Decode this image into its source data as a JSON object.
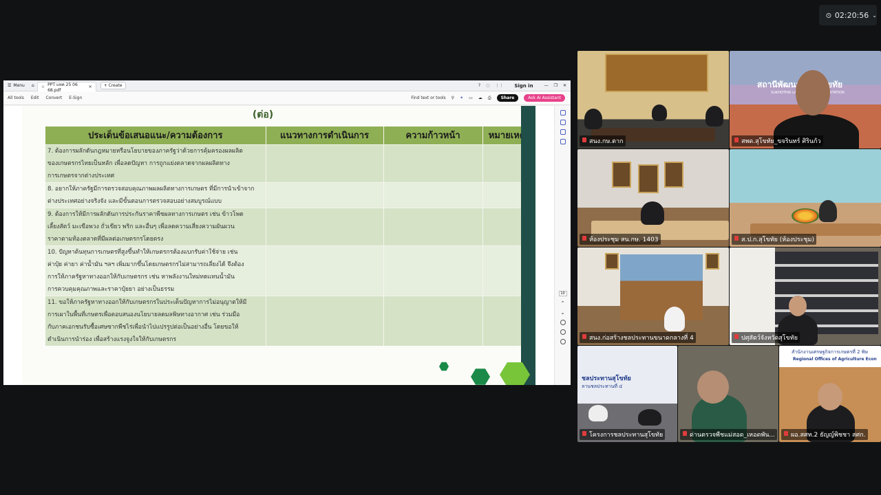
{
  "clock": {
    "time": "02:20:56"
  },
  "pdf_window": {
    "menu_label": "Menu",
    "tab_title": "PPT แทค 25 06 68.pdf",
    "create_label": "Create",
    "sign_in": "Sign in",
    "toolbar": {
      "items": [
        "All tools",
        "Edit",
        "Convert",
        "E-Sign"
      ],
      "find_label": "Find text or tools",
      "share_label": "Share",
      "ai_label": "Ask AI Assistant"
    },
    "page_number": "10",
    "slide": {
      "title": "(ต่อ)",
      "headers": [
        "ประเด็นข้อเสนอแนะ/ความต้องการ",
        "แนวทางการดำเนินการ",
        "ความก้าวหน้า",
        "หมายเหตุ"
      ],
      "rows": [
        {
          "lines": [
            "7. ต้องการผลักดันกฎหมายหรือนโยบายของภาครัฐว่าด้วยการคุ้มครองผลผลิต",
            "ของเกษตรกรไทยเป็นหลัก เพื่อลดปัญหา การถูกแย่งตลาดจากผลผลิตทาง",
            "การเกษตรจากต่างประเทศ"
          ]
        },
        {
          "lines": [
            "8. อยากให้ภาครัฐมีการตรวจสอบคุณภาพผลผลิตทางการเกษตร ที่มีการนำเข้าจาก",
            "ต่างประเทศอย่างจริงจัง และมีขั้นตอนการตรวจสอบอย่างสมบูรณ์แบบ"
          ]
        },
        {
          "lines": [
            "9. ต้องการให้มีการผลักดันการประกันราคาพืชผลทางการเกษตร เช่น ข้าวโพด",
            "เลี้ยงสัตว์ มะเขือพวง ถั่วเขียว พริก และอื่นๆ เพื่อลดความเสี่ยงความผันผวน",
            "ราคาตามท้องตลาดที่มีผลต่อเกษตรกรโดยตรง"
          ]
        },
        {
          "lines": [
            "10. ปัญหาต้นทุนการเกษตรที่สูงขึ้นทำให้เกษตรกรต้องแบกรับค่าใช้จ่าย เช่น",
            "ค่าปุ๋ย ค่ายา ค่าน้ำมัน ฯลฯ เพิ่มมากขึ้นโดยเกษตรกรไม่สามารถเลี่ยงได้ จึงต้อง",
            "การให้ภาครัฐหาทางออกให้กับเกษตรกร เช่น หาพลังงานใหม่ทดแทนน้ำมัน",
            "การควบคุมคุณภาพและราคาปุ๋ยยา อย่างเป็นธรรม"
          ]
        },
        {
          "lines": [
            "11. ขอให้ภาครัฐหาทางออกให้กับเกษตรกรในประเด็นปัญหาการไม่อนุญาตให้มี",
            "การเผาในพื้นที่เกษตรเพื่อตอบสนองนโยบายลดมลพิษทางอากาศ เช่น ร่วมมือ",
            "กับภาคเอกชนรับซื้อเศษซากพืชไร่เพื่อนำไปแปรรูปต่อเป็นอย่างอื่น โดยขอให้",
            "ดำเนินการนำร่อง เพื่อสร้างแรงจูงใจให้กับเกษตรกร"
          ]
        }
      ]
    }
  },
  "gallery": {
    "tiles": [
      {
        "id": "t1",
        "name": "สนง.กษ.ตาก",
        "active": true
      },
      {
        "id": "t2",
        "name": "สพด.สุโขทัย_ขจรินทร์ ศิรินก้ว",
        "sign_title": "สถานีพัฒนาที่ดินสุโขทัย",
        "sign_sub": "SUKHOTHAI LAND DEVELOPMENT STATION"
      },
      {
        "id": "t3",
        "name": "ห้องประชุม สน.กษ. 1403"
      },
      {
        "id": "t4",
        "name": "ส.ป.ก.สุโขทัย (ห้องประชุม)"
      },
      {
        "id": "t5",
        "name": "สนง.ก่อสร้างชลประทานขนาดกลางที่ 4"
      },
      {
        "id": "t6",
        "name": "ปศุสัตว์จังหวัดสุโขทัย"
      },
      {
        "id": "t7",
        "name": "โครงการชลประทานสุโขทัย",
        "banner": "ชลประทานสุโขทัย",
        "banner_sub": "ลานชลประทานที่ ๔"
      },
      {
        "id": "t8",
        "name": "ด่านตรวจพืชแม่สอด_เหอดพัน..."
      },
      {
        "id": "t9",
        "name": "ผอ.สศท.2 ธัญญ์พิชชา สศก.",
        "banner": "สำนักงานเศรษฐกิจการเกษตรที่ 2 พิษ",
        "banner_sub": "Regional Offices of Agriculture Econ"
      }
    ]
  }
}
